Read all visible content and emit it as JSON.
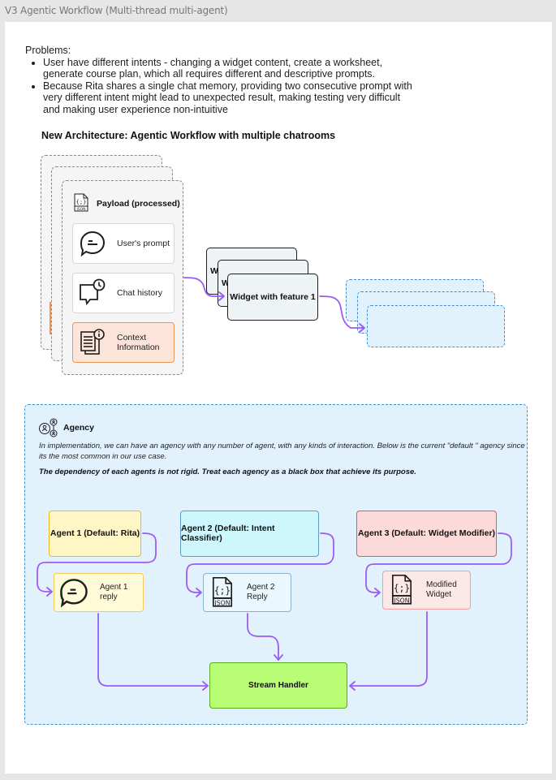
{
  "window": {
    "title": "V3 Agentic Workflow (Multi-thread multi-agent)"
  },
  "problems": {
    "heading": "Problems:",
    "items": [
      "User have different intents - changing a widget content, create a worksheet, generate course plan, which all requires different and descriptive prompts.",
      "Because Rita shares a single chat memory, providing two consecutive prompt with very different intent might lead to unexpected result, making testing very difficult and making user experience non-intuitive"
    ]
  },
  "architecture": {
    "title": "New Architecture: Agentic Workflow with multiple chatrooms",
    "payload": {
      "title": "Payload (processed)",
      "icon": "json-file-icon",
      "items": [
        {
          "label": "User's prompt",
          "icon": "chat-bubble-icon"
        },
        {
          "label": "Chat history",
          "icon": "chat-history-icon"
        },
        {
          "label": "Context Information",
          "icon": "document-info-icon"
        }
      ]
    },
    "widgets": {
      "back_labels": [
        "W",
        "W"
      ],
      "front_label": "Widget with feature 1"
    }
  },
  "agency": {
    "title": "Agency",
    "icon": "agents-network-icon",
    "description": "In implementation, we can have an agency with any number of agent, with any kinds of interaction. Below is the current \"default \" agency since its the most common in our use case.",
    "note": "The dependency of each agents is not rigid. Treat each agency as a black box that achieve its purpose.",
    "agents": [
      {
        "label": "Agent 1 (Default: Rita)",
        "reply": "Agent 1 reply",
        "reply_icon": "chat-bubble-icon",
        "fill": "#fff6c6",
        "border": "#f6b51e",
        "reply_fill": "#fffbd9",
        "reply_border": "#f7c860"
      },
      {
        "label": "Agent 2 (Default: Intent Classifier)",
        "reply": "Agent 2 Reply",
        "reply_icon": "json-file-icon",
        "fill": "#cdf7fd",
        "border": "#5e9dbd",
        "reply_fill": "#eaf7fd",
        "reply_border": "#8ab4cd"
      },
      {
        "label": "Agent 3 (Default: Widget Modifier)",
        "reply": "Modified Widget",
        "reply_icon": "json-file-icon",
        "fill": "#fcdada",
        "border": "#e85659",
        "reply_fill": "#fde8e8",
        "reply_border": "#eea0a2"
      }
    ],
    "stream_handler": "Stream Handler"
  },
  "colors": {
    "arrow": "#9b5cf3",
    "agency_border": "#3a8fd6",
    "agency_fill": "#e2f2fd",
    "stream_fill": "#b9fd75",
    "stream_border": "#5aac1c"
  }
}
